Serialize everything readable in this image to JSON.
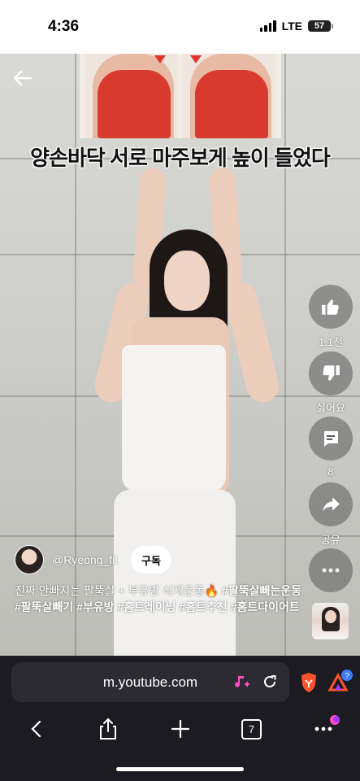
{
  "status_bar": {
    "time": "4:36",
    "network": "LTE",
    "battery": "57"
  },
  "video": {
    "overlay_caption": "양손바닥 서로 마주보게 높이 들었다"
  },
  "actions": {
    "like_count": "1.1천",
    "dislike_label": "싫어요",
    "comment_count": "8",
    "share_label": "공유"
  },
  "channel": {
    "handle": "@Ryeong_fit",
    "subscribe_label": "구독"
  },
  "description": {
    "text": "진짜 안빠지는 팔뚝살 + 부유방 삭제운동🔥",
    "hashtags": "#팔뚝살빼는운동 #팔뚝살빼기 #부유방 #홈트레이닝 #홈트추천 #홈트다이어트"
  },
  "browser": {
    "url": "m.youtube.com",
    "tab_count": "7",
    "badge": "?"
  },
  "colors": {
    "browser_bg": "#1c1b22",
    "urlbar_bg": "#2c2b33",
    "brave_orange": "#fb542b",
    "music_pink": "#ff4fc1"
  }
}
